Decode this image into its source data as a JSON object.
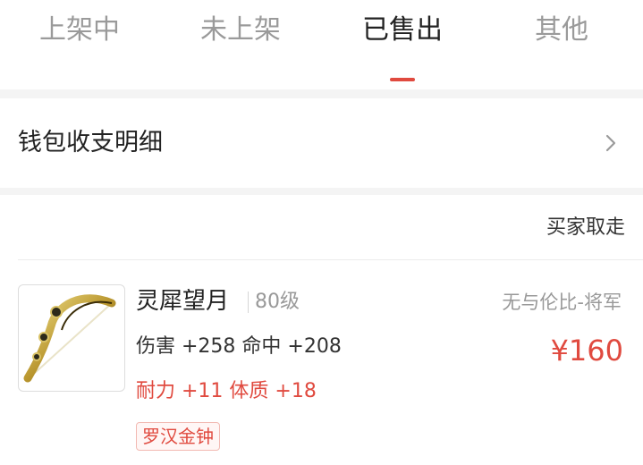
{
  "tabs": [
    {
      "label": "上架中",
      "active": false
    },
    {
      "label": "未上架",
      "active": false
    },
    {
      "label": "已售出",
      "active": true
    },
    {
      "label": "其他",
      "active": false
    }
  ],
  "wallet": {
    "label": "钱包收支明细",
    "icon": "chevron-right-icon"
  },
  "order": {
    "status": "买家取走",
    "item": {
      "name": "灵犀望月",
      "level": "80级",
      "seller": "无与伦比-将军",
      "stats_primary": "伤害 +258 命中 +208",
      "stats_secondary": "耐力 +11 体质 +18",
      "tag": "罗汉金钟",
      "price": "¥160",
      "image": "golden-bow-icon"
    }
  },
  "colors": {
    "accent": "#e04a3f",
    "text_dark": "#222222",
    "text_muted": "#999999"
  }
}
